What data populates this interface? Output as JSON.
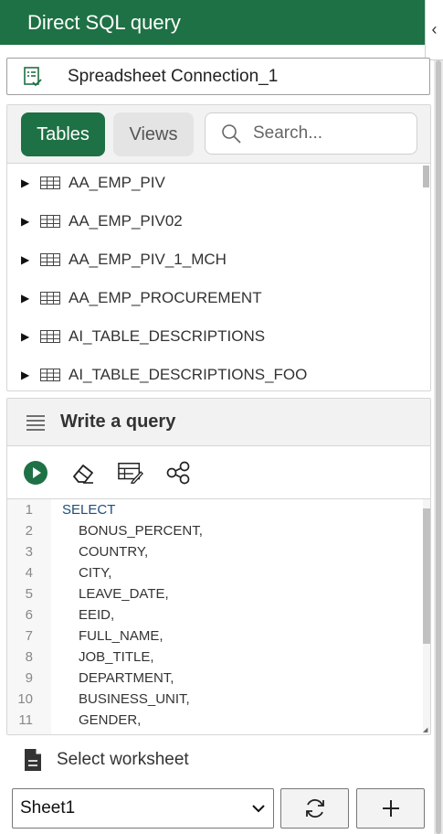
{
  "header": {
    "title": "Direct SQL query",
    "collapse_icon": "chevron-left-icon",
    "collapse_glyph": "‹"
  },
  "connection": {
    "name": "Spreadsheet Connection_1",
    "icon": "database-check-icon"
  },
  "tables_panel": {
    "tabs": [
      {
        "label": "Tables",
        "active": true
      },
      {
        "label": "Views",
        "active": false
      }
    ],
    "search": {
      "placeholder": "Search...",
      "value": ""
    },
    "items": [
      {
        "name": "AA_EMP_PIV"
      },
      {
        "name": "AA_EMP_PIV02"
      },
      {
        "name": "AA_EMP_PIV_1_MCH"
      },
      {
        "name": "AA_EMP_PROCUREMENT"
      },
      {
        "name": "AI_TABLE_DESCRIPTIONS"
      },
      {
        "name": "AI_TABLE_DESCRIPTIONS_FOO"
      }
    ]
  },
  "query_panel": {
    "title": "Write a query",
    "toolbar": [
      "run-icon",
      "eraser-icon",
      "format-sql-icon",
      "share-icon"
    ],
    "lines": [
      {
        "n": "1",
        "text": "SELECT"
      },
      {
        "n": "2",
        "text": "BONUS_PERCENT,"
      },
      {
        "n": "3",
        "text": "COUNTRY,"
      },
      {
        "n": "4",
        "text": "CITY,"
      },
      {
        "n": "5",
        "text": "LEAVE_DATE,"
      },
      {
        "n": "6",
        "text": "EEID,"
      },
      {
        "n": "7",
        "text": "FULL_NAME,"
      },
      {
        "n": "8",
        "text": "JOB_TITLE,"
      },
      {
        "n": "9",
        "text": "DEPARTMENT,"
      },
      {
        "n": "10",
        "text": "BUSINESS_UNIT,"
      },
      {
        "n": "11",
        "text": "GENDER,"
      }
    ]
  },
  "worksheet": {
    "label": "Select worksheet",
    "selected": "Sheet1",
    "refresh_icon": "refresh-icon",
    "add_icon": "plus-icon"
  },
  "colors": {
    "brand_green": "#1e7145",
    "sql_keyword": "#1f4e79"
  }
}
